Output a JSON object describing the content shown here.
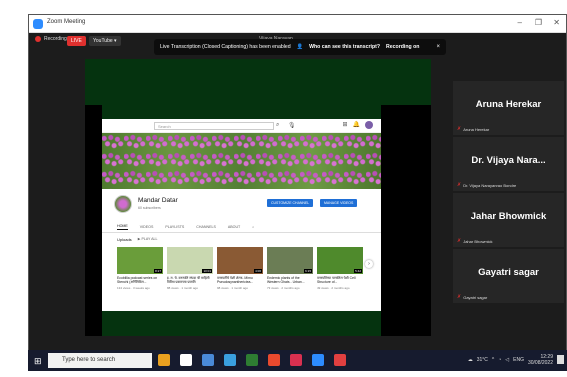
{
  "window": {
    "title": "Zoom Meeting",
    "minimize": "–",
    "restore": "❐",
    "close": "✕"
  },
  "topbar": {
    "recording": "Recording",
    "live": "LIVE",
    "youtube": "YouTube ▾",
    "speaker": "Vijaya Narayan..."
  },
  "banner": {
    "text": "Live Transcription (Closed Captioning) has been enabled",
    "link": "Who can see this transcript?",
    "recording": "Recording on",
    "close": "×"
  },
  "youtube": {
    "search_placeholder": "Search",
    "channel_name": "Mandar Datar",
    "subscribers": "60 subscribers",
    "customize_btn": "CUSTOMIZE CHANNEL",
    "manage_btn": "MANAGE VIDEOS",
    "tabs": [
      "HOME",
      "VIDEOS",
      "PLAYLISTS",
      "CHANNELS",
      "ABOUT"
    ],
    "section": "Uploads",
    "play_all": "PLAY ALL",
    "videos": [
      {
        "title": "Ecobillia podcast series on Stenchi (अर्गितिविल...",
        "meta": "134 views · 3 weeks ago",
        "duration": "8:27",
        "color": "#6a9d3a"
      },
      {
        "title": "इ. म. चे. वनस्पति संपदा ची माहिती विविध प्रकारच्या प्रजाति",
        "meta": "88 views · 1 month ago",
        "duration": "10:01",
        "color": "#c9d8b0"
      },
      {
        "title": "वनस्पतींचे पेशी शेल्फ- Mimu Pseudosynanthericiea...",
        "meta": "98 views · 1 month ago",
        "duration": "4:06",
        "color": "#8a5a34"
      },
      {
        "title": "Endemic plants of the Western Ghats - Urban...",
        "meta": "73 views · 2 months ago",
        "duration": "6:15",
        "color": "#6b7d55"
      },
      {
        "title": "वनस्पतिंच्या पानातिल पेशी Cell Structure of...",
        "meta": "49 views · 2 months ago",
        "duration": "5:42",
        "color": "#4f8a2c"
      }
    ]
  },
  "participants": [
    {
      "display": "Aruna Herekar",
      "label": "Aruna Herekar"
    },
    {
      "display": "Dr. Vijaya Nara...",
      "label": "Dr. Vijaya Narayanrao Bondre"
    },
    {
      "display": "Jahar Bhowmick",
      "label": "Jahar Bhowmick"
    },
    {
      "display": "Gayatri sagar",
      "label": "Gayatri sagar"
    }
  ],
  "taskbar": {
    "search_placeholder": "Type here to search",
    "weather": "31°C",
    "lang": "ENG",
    "time": "12:29",
    "date": "30/08/2022",
    "icon_colors": [
      "#e8a020",
      "#ffffff",
      "#4a8ad8",
      "#3aa0e0",
      "#2e7d32",
      "#e84a2e",
      "#d83050",
      "#2d8cff",
      "#e04040"
    ]
  }
}
